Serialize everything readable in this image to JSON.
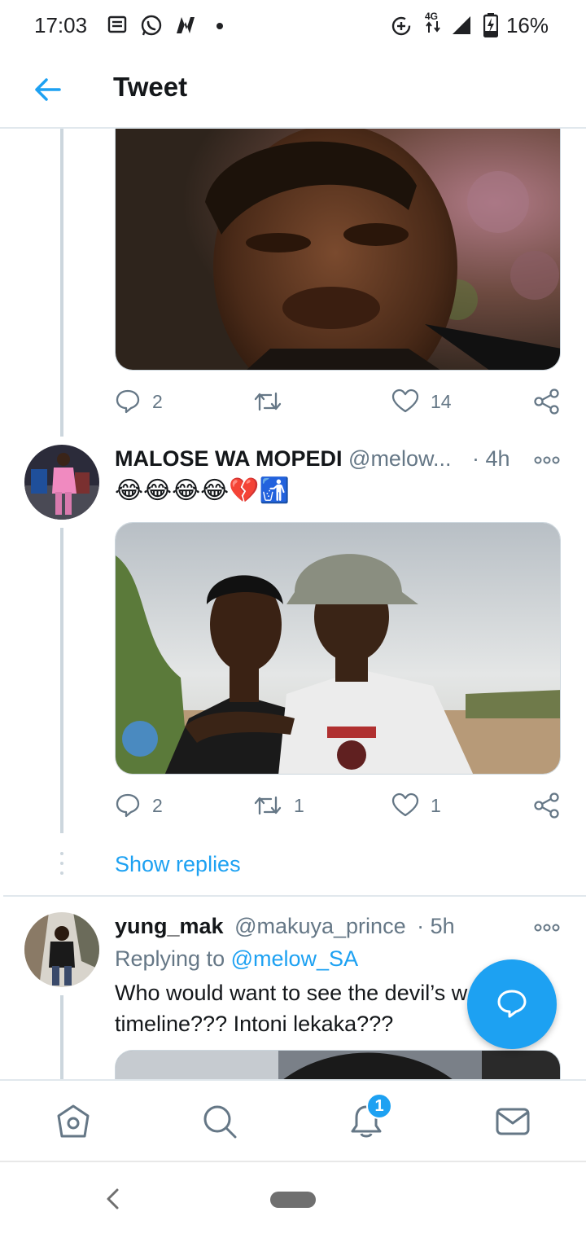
{
  "status_bar": {
    "time": "17:03",
    "network": "4G",
    "battery": "16%",
    "icons": [
      "news-icon",
      "whatsapp-icon",
      "n-app-icon",
      "dot-icon",
      "data-saver-icon",
      "signal-icon",
      "battery-charging-icon"
    ]
  },
  "header": {
    "title": "Tweet",
    "back_icon": "back-arrow-icon"
  },
  "tweet1": {
    "media_alt": "crying-man-meme-image",
    "actions": {
      "reply_count": "2",
      "retweet_count": "",
      "like_count": "14"
    }
  },
  "tweet2": {
    "display_name": "MALOSE WA MOPEDI",
    "handle": "@melow...",
    "time": "· 4h",
    "emoji_text": "😂😂😂😂💔🚮",
    "media_alt": "two-young-men-photo",
    "actions": {
      "reply_count": "2",
      "retweet_count": "1",
      "like_count": "1"
    }
  },
  "show_replies": "Show replies",
  "tweet3": {
    "display_name": "yung_mak",
    "handle": "@makuya_prince",
    "time": "· 5h",
    "replying_prefix": "Replying to",
    "replying_handle": "@melow_SA",
    "text": "Who would want to see the devil’s w... my timeline??? Intoni lekaka???"
  },
  "bottom_nav": {
    "items": [
      "home-icon",
      "search-icon",
      "notifications-icon",
      "messages-icon"
    ],
    "notification_badge": "1"
  },
  "colors": {
    "accent": "#1da1f2",
    "text_primary": "#14171a",
    "text_secondary": "#657786",
    "divider": "#e1e8ed"
  }
}
